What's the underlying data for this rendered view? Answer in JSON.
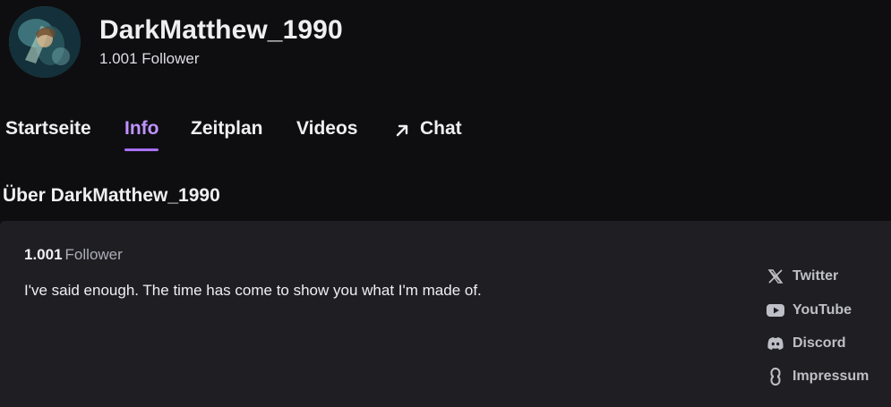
{
  "channel": {
    "name": "DarkMatthew_1990",
    "followers_text": "1.001 Follower"
  },
  "tabs": [
    {
      "label": "Startseite",
      "active": false
    },
    {
      "label": "Info",
      "active": true
    },
    {
      "label": "Zeitplan",
      "active": false
    },
    {
      "label": "Videos",
      "active": false
    },
    {
      "label": "Chat",
      "active": false,
      "icon": "arrow-up-right-icon"
    }
  ],
  "about": {
    "heading": "Über DarkMatthew_1990",
    "follower_count": "1.001",
    "follower_label": "Follower",
    "bio": "I've said enough. The time has come to show you what I'm made of."
  },
  "social_links": [
    {
      "label": "Twitter",
      "icon": "x-twitter-icon"
    },
    {
      "label": "YouTube",
      "icon": "youtube-icon"
    },
    {
      "label": "Discord",
      "icon": "discord-icon"
    },
    {
      "label": "Impressum",
      "icon": "link-icon"
    }
  ],
  "colors": {
    "background": "#0e0e10",
    "panel": "#1f1f23",
    "accent": "#bf94ff",
    "accent_underline": "#a970ff",
    "text": "#efeff1",
    "muted": "#adadb8"
  }
}
